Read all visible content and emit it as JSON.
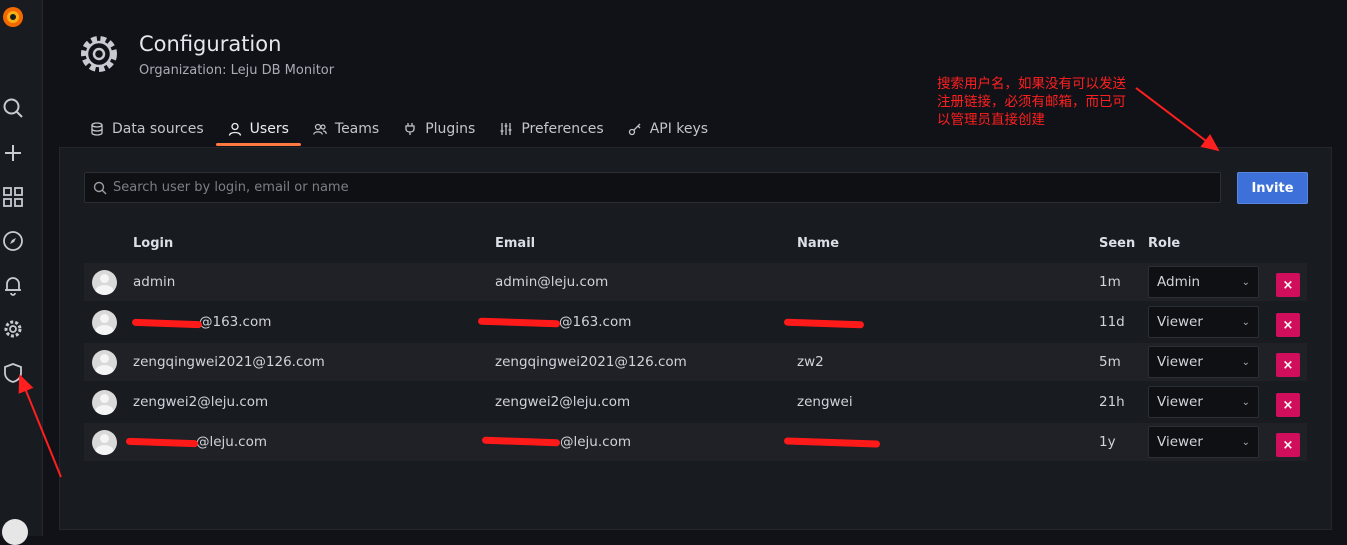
{
  "header": {
    "title": "Configuration",
    "subtitle": "Organization: Leju DB Monitor"
  },
  "tabs": [
    {
      "label": "Data sources",
      "icon": "database-icon"
    },
    {
      "label": "Users",
      "icon": "user-icon",
      "active": true
    },
    {
      "label": "Teams",
      "icon": "users-icon"
    },
    {
      "label": "Plugins",
      "icon": "plug-icon"
    },
    {
      "label": "Preferences",
      "icon": "sliders-icon"
    },
    {
      "label": "API keys",
      "icon": "key-icon"
    }
  ],
  "search": {
    "placeholder": "Search user by login, email or name"
  },
  "invite_label": "Invite",
  "columns": {
    "login": "Login",
    "email": "Email",
    "name": "Name",
    "seen": "Seen",
    "role": "Role"
  },
  "users": [
    {
      "login": "admin",
      "email": "admin@leju.com",
      "name": "",
      "seen": "1m",
      "role": "Admin"
    },
    {
      "login": "@163.com",
      "email": "@163.com",
      "name": "",
      "seen": "11d",
      "role": "Viewer"
    },
    {
      "login": "zengqingwei2021@126.com",
      "email": "zengqingwei2021@126.com",
      "name": "zw2",
      "seen": "5m",
      "role": "Viewer"
    },
    {
      "login": "zengwei2@leju.com",
      "email": "zengwei2@leju.com",
      "name": "zengwei",
      "seen": "21h",
      "role": "Viewer"
    },
    {
      "login": "@leju.com",
      "email": "@leju.com",
      "name": "",
      "seen": "1y",
      "role": "Viewer"
    }
  ],
  "delete_label": "×",
  "annotation": "搜索用户名，如果没有可以发送注册链接，必须有邮箱，而已可以管理员直接创建",
  "colors": {
    "accent_tab": "#ff7941",
    "invite": "#3d71d9",
    "delete": "#d10e5c",
    "annotation": "#ff1f1f"
  }
}
